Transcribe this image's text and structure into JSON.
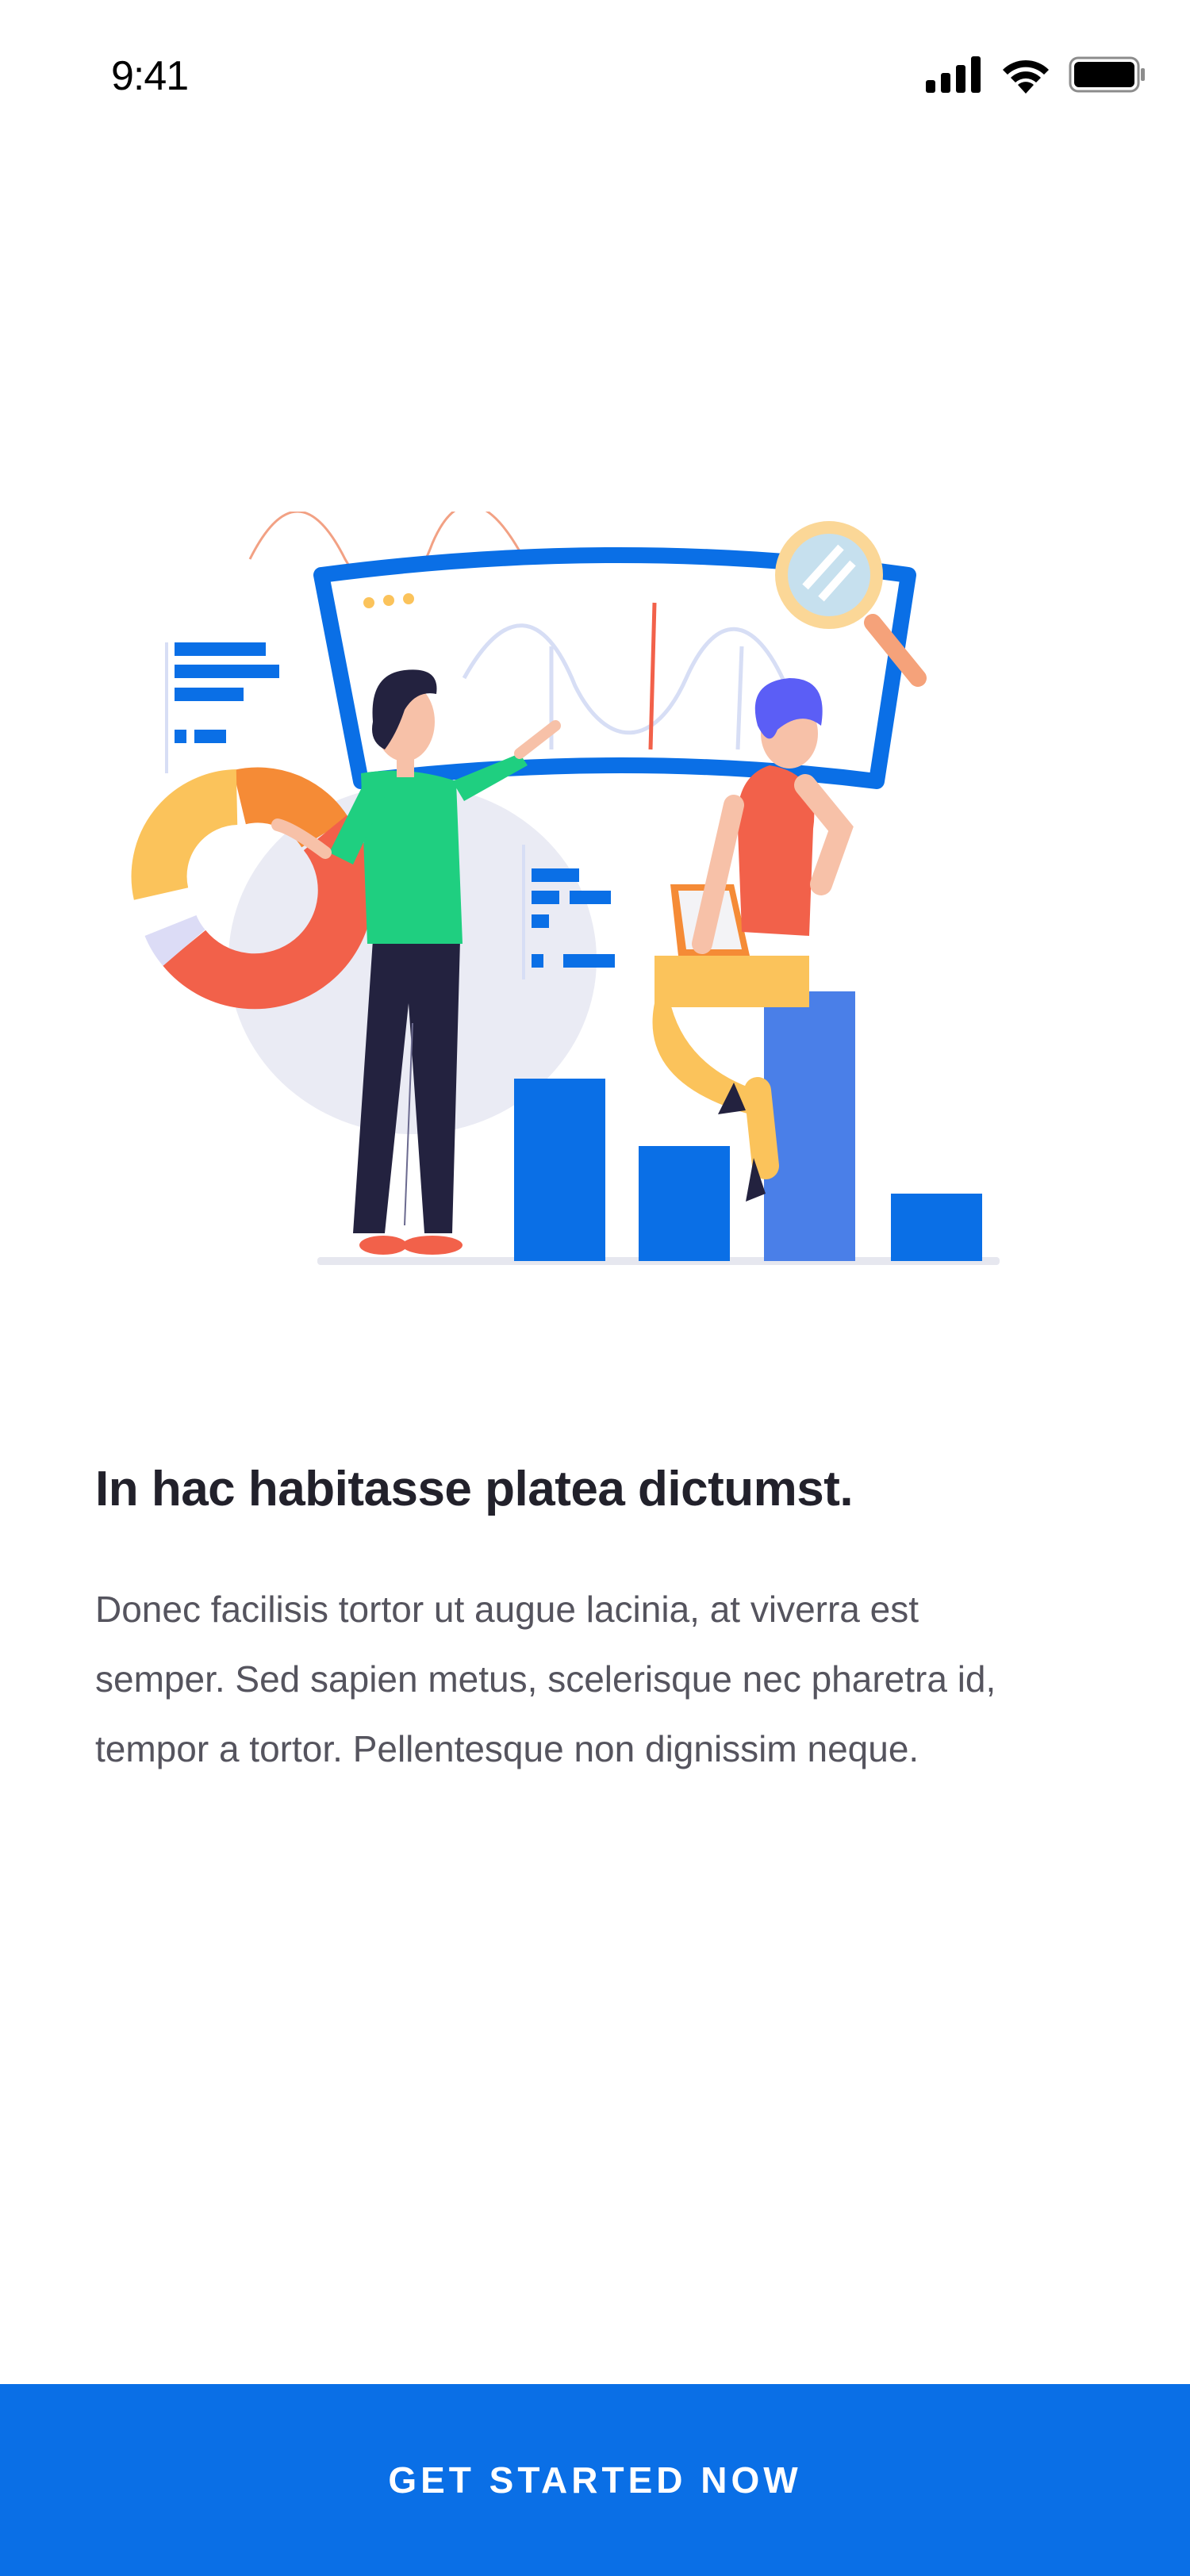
{
  "status_bar": {
    "time": "9:41",
    "icons": [
      "cellular-signal-icon",
      "wifi-icon",
      "battery-icon"
    ]
  },
  "illustration": {
    "name": "analytics-team-illustration",
    "colors": {
      "primary_blue": "#0a6fe6",
      "light_blue": "#4a7fe8",
      "coral": "#f2614a",
      "orange": "#f58b36",
      "yellow": "#fbc35b",
      "green": "#1fcf80",
      "navy": "#23223f",
      "blob": "#eaebf4"
    }
  },
  "content": {
    "heading": "In hac habitasse platea dictumst.",
    "body": "Donec facilisis tortor ut augue lacinia, at viverra est semper. Sed sapien metus, scelerisque nec pharetra id, tempor a tortor. Pellentesque non dignissim neque."
  },
  "cta": {
    "label": "GET STARTED NOW",
    "color": "#0a6fe6"
  }
}
